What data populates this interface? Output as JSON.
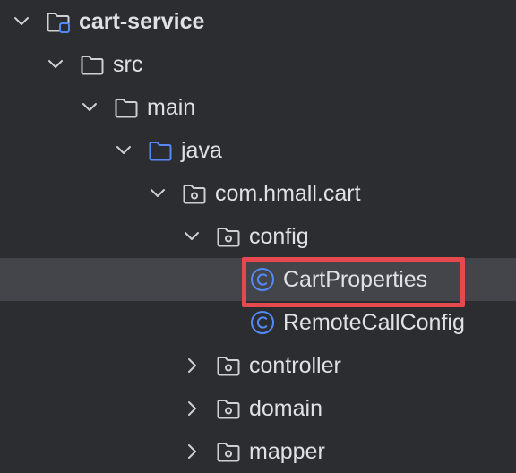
{
  "project_tree": {
    "items": [
      {
        "label": "cart-service",
        "expanded": true,
        "kind": "module",
        "icon": "module-folder-icon"
      },
      {
        "label": "src",
        "expanded": true,
        "kind": "folder",
        "icon": "folder-icon"
      },
      {
        "label": "main",
        "expanded": true,
        "kind": "folder",
        "icon": "folder-icon"
      },
      {
        "label": "java",
        "expanded": true,
        "kind": "source-folder",
        "icon": "source-folder-icon"
      },
      {
        "label": "com.hmall.cart",
        "expanded": true,
        "kind": "package",
        "icon": "package-icon"
      },
      {
        "label": "config",
        "expanded": true,
        "kind": "package",
        "icon": "package-icon"
      },
      {
        "label": "CartProperties",
        "kind": "class",
        "icon": "class-icon",
        "selected": true,
        "highlighted": true
      },
      {
        "label": "RemoteCallConfig",
        "kind": "class",
        "icon": "class-icon"
      },
      {
        "label": "controller",
        "expanded": false,
        "kind": "package",
        "icon": "package-icon"
      },
      {
        "label": "domain",
        "expanded": false,
        "kind": "package",
        "icon": "package-icon"
      },
      {
        "label": "mapper",
        "expanded": false,
        "kind": "package",
        "icon": "package-icon"
      }
    ]
  },
  "colors": {
    "background": "#2b2d30",
    "selection": "#43454a",
    "text": "#dfe1e5",
    "icon_gray": "#ced0d6",
    "source_folder_blue": "#548af7",
    "class_blue": "#548af7",
    "highlight_red": "#e5484d"
  }
}
